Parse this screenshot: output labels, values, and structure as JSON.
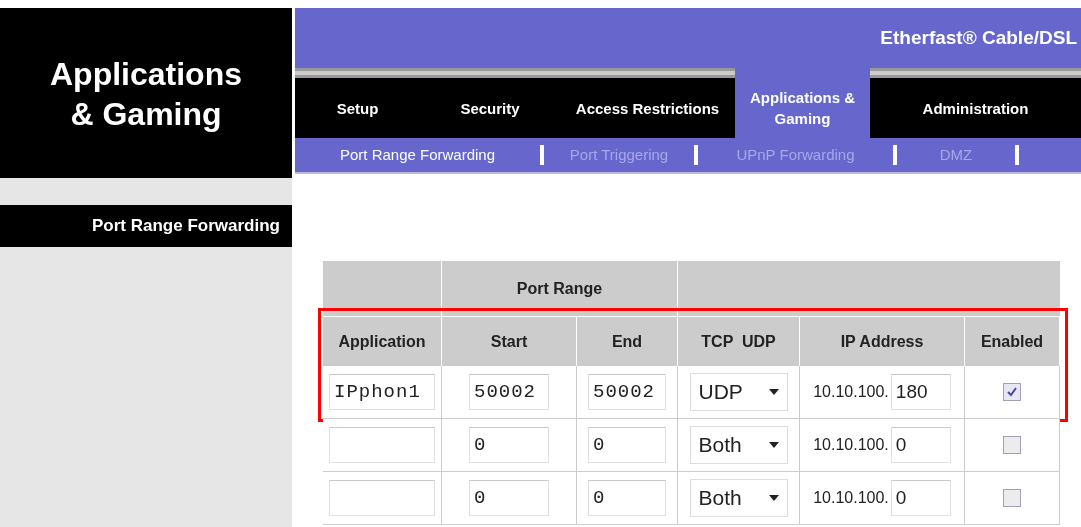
{
  "section_title": "Applications & Gaming",
  "product_name": "Etherfast® Cable/DSL",
  "tabs": [
    {
      "label": "Setup",
      "selected": false
    },
    {
      "label": "Security",
      "selected": false
    },
    {
      "label": "Access Restrictions",
      "selected": false
    },
    {
      "label": "Applications & Gaming",
      "selected": true
    },
    {
      "label": "Administration",
      "selected": false
    }
  ],
  "sub_tabs": [
    {
      "label": "Port Range Forwarding",
      "selected": true
    },
    {
      "label": "Port Triggering",
      "selected": false
    },
    {
      "label": "UPnP Forwarding",
      "selected": false
    },
    {
      "label": "DMZ",
      "selected": false
    }
  ],
  "sidebar": {
    "label": "Port Range Forwarding"
  },
  "table": {
    "group_header": "Port Range",
    "columns": [
      "Application",
      "Start",
      "End",
      "TCP  UDP",
      "IP Address",
      "Enabled"
    ],
    "rows": [
      {
        "application": "IPphon1",
        "start": "50002",
        "end": "50002",
        "protocol": "UDP",
        "ip_prefix": "10.10.100.",
        "ip_last": "180",
        "enabled": true,
        "highlighted": true
      },
      {
        "application": "",
        "start": "0",
        "end": "0",
        "protocol": "Both",
        "ip_prefix": "10.10.100.",
        "ip_last": "0",
        "enabled": false,
        "highlighted": false
      },
      {
        "application": "",
        "start": "0",
        "end": "0",
        "protocol": "Both",
        "ip_prefix": "10.10.100.",
        "ip_last": "0",
        "enabled": false,
        "highlighted": false
      }
    ]
  }
}
